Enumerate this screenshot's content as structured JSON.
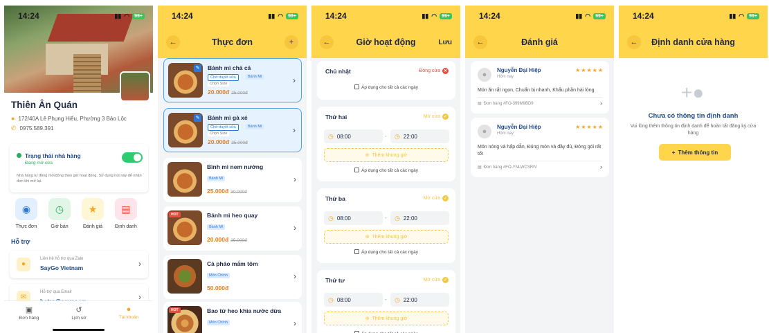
{
  "status": {
    "time": "14:24",
    "battery": "99+"
  },
  "profile": {
    "name": "Thiên Ân Quán",
    "address": "172/40A Lê Phụng Hiểu, Phường 3 Bảo Lộc",
    "phone": "0975.589.391",
    "status_title": "Trạng thái nhà hàng",
    "status_value": "Đang mở cửa",
    "status_note": "Nhà hàng tự động mở/đóng theo giờ hoạt động. Sử dụng nút này để nhận đơn khi mở lại.",
    "quick": [
      "Thực đơn",
      "Giờ bán",
      "Đánh giá",
      "Định danh"
    ],
    "support_title": "Hỗ trợ",
    "support": [
      {
        "caption": "Liên hệ hỗ trợ qua Zalo",
        "value": "SayGo Vietnam"
      },
      {
        "caption": "Hỗ trợ qua Email",
        "value": "hotro@saygo.vn"
      }
    ],
    "tabs": [
      "Đơn hàng",
      "Lịch sử",
      "Tài khoản"
    ]
  },
  "menu": {
    "title": "Thực đơn",
    "items": [
      {
        "name": "Bánh mì chả cá",
        "chip1": "Chờ duyệt sửa",
        "chip2": "Bánh Mì",
        "size": "Chọn Size",
        "price": "20.000đ",
        "old": "25.000đ"
      },
      {
        "name": "Bánh mì gà xé",
        "chip1": "Chờ duyệt sửa",
        "chip2": "Bánh Mì",
        "size": "Chọn Size",
        "price": "20.000đ",
        "old": "25.000đ"
      },
      {
        "name": "Bình mì nem nướng",
        "chip2": "Bánh Mì",
        "price": "25.000đ",
        "old": "30.000đ"
      },
      {
        "name": "Bánh mì heo quay",
        "chip2": "Bánh Mì",
        "price": "20.000đ",
        "old": "25.000đ",
        "hot": "HOT"
      },
      {
        "name": "Cà pháo mắm tôm",
        "chip2": "Món Chính",
        "price": "50.000đ"
      },
      {
        "name": "Bao tử heo khìa nước dừa",
        "chip2": "Món Chính",
        "hot": "HOT"
      }
    ]
  },
  "hours": {
    "title": "Giờ hoạt động",
    "save": "Lưu",
    "apply_all": "Áp dụng cho tất cả các ngày",
    "add_slot": "Thêm khung giờ",
    "closed_label": "Đóng cửa",
    "open_label": "Mở cửa",
    "days": [
      {
        "name": "Chủ nhật"
      },
      {
        "name": "Thứ hai",
        "from": "08:00",
        "to": "22:00"
      },
      {
        "name": "Thứ ba",
        "from": "08:00",
        "to": "22:00"
      },
      {
        "name": "Thứ tư",
        "from": "08:00",
        "to": "22:00"
      }
    ]
  },
  "reviews": {
    "title": "Đánh giá",
    "items": [
      {
        "name": "Nguyễn Đại Hiệp",
        "time": "Hôm nay",
        "text": "Món ăn rất ngon, Chuẩn bị nhanh, Khẩu phần hài lòng",
        "order": "Đơn hàng #FO-399M9BD9",
        "rating": 5
      },
      {
        "name": "Nguyễn Đại Hiệp",
        "time": "Hôm nay",
        "text": "Món nóng và hấp dẫn, Đúng món và đầy đủ, Đóng gói rất tốt",
        "order": "Đơn hàng #FO-YNLWCSRIV",
        "rating": 5
      }
    ]
  },
  "identity": {
    "title": "Định danh cửa hàng",
    "empty_title": "Chưa có thông tin định danh",
    "empty_desc": "Vui lòng thêm thông tin định danh để hoàn tất đăng ký cửa hàng",
    "button": "Thêm thông tin"
  }
}
